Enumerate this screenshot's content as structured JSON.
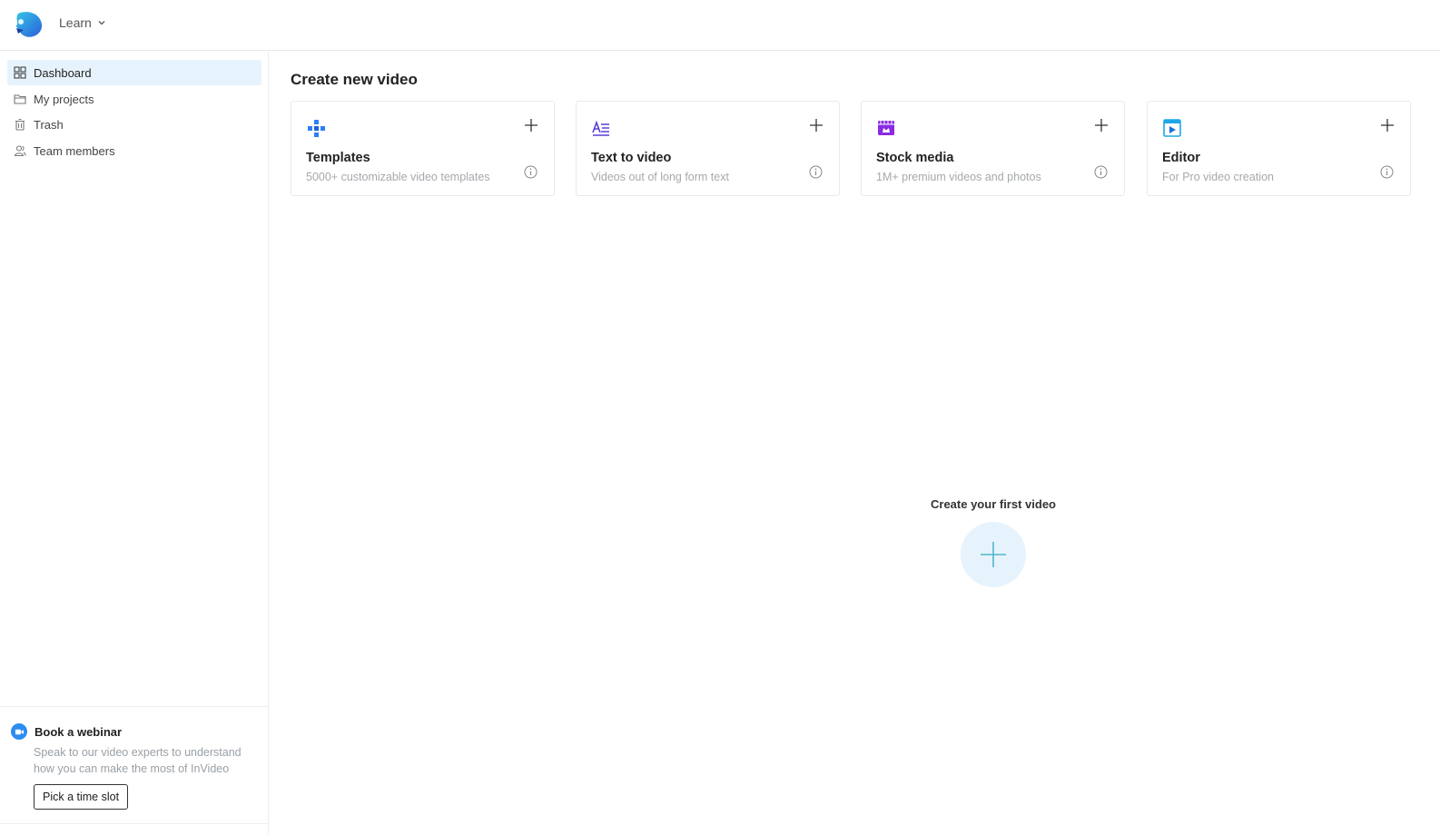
{
  "header": {
    "logo_icon": "invideo-logo",
    "learn_label": "Learn"
  },
  "sidebar": {
    "items": [
      {
        "label": "Dashboard",
        "icon": "grid-icon",
        "active": true
      },
      {
        "label": "My projects",
        "icon": "folder-icon",
        "active": false
      },
      {
        "label": "Trash",
        "icon": "trash-icon",
        "active": false
      },
      {
        "label": "Team members",
        "icon": "users-icon",
        "active": false
      }
    ],
    "webinar": {
      "title": "Book a webinar",
      "description": "Speak to our video experts to understand how you can make the most of InVideo",
      "button_label": "Pick a time slot"
    }
  },
  "main": {
    "title": "Create new video",
    "cards": [
      {
        "title": "Templates",
        "subtitle": "5000+ customizable video templates",
        "icon": "templates-icon",
        "color": "#2d7ff9"
      },
      {
        "title": "Text to video",
        "subtitle": "Videos out of long form text",
        "icon": "text-to-video-icon",
        "color": "#5b3fd6"
      },
      {
        "title": "Stock media",
        "subtitle": "1M+ premium videos and photos",
        "icon": "stock-media-icon",
        "color": "#8a2be2"
      },
      {
        "title": "Editor",
        "subtitle": "For Pro video creation",
        "icon": "editor-icon",
        "color": "#1ea7e8"
      }
    ],
    "empty_state": {
      "label": "Create your first video"
    }
  },
  "colors": {
    "accent_light": "#e6f3fc",
    "accent": "#2d8cf0",
    "plus_teal": "#4fb7c9"
  }
}
